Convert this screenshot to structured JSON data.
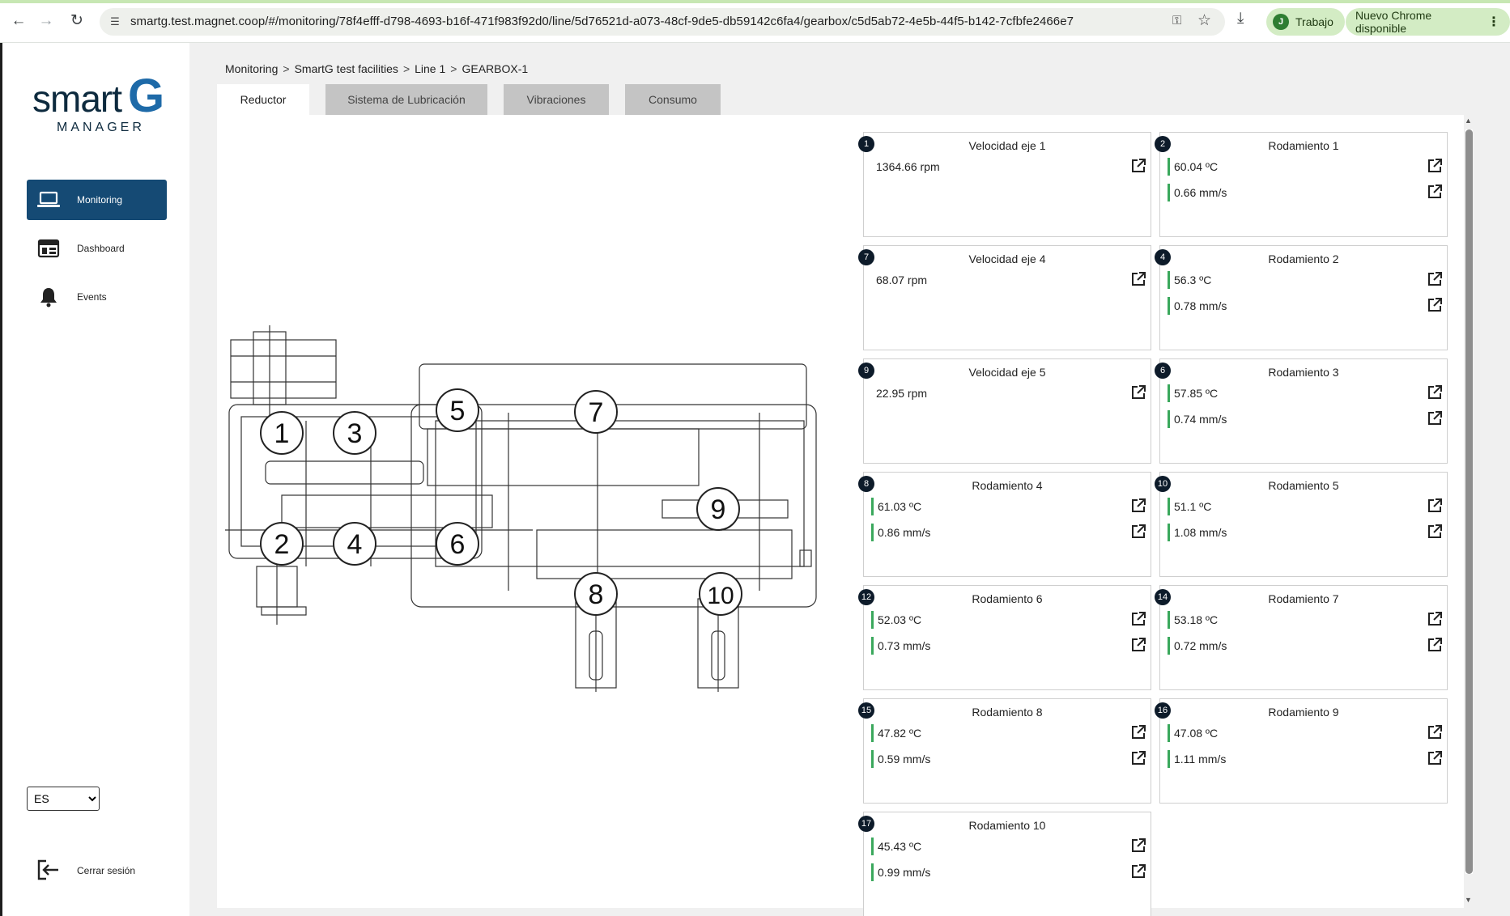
{
  "browser": {
    "url": "smartg.test.magnet.coop/#/monitoring/78f4efff-d798-4693-b16f-471f983f92d0/line/5d76521d-a073-48cf-9de5-db59142c6fa4/gearbox/c5d5ab72-4e5b-44f5-b142-7cfbfe2466e7",
    "profile_initial": "J",
    "profile_label": "Trabajo",
    "update_label": "Nuevo Chrome disponible",
    "accent_color": "#c7e7b3"
  },
  "logo": {
    "word": "smart",
    "letter": "G",
    "subtitle": "MANAGER"
  },
  "sidebar": {
    "items": [
      {
        "label": "Monitoring",
        "icon": "laptop-icon",
        "active": true
      },
      {
        "label": "Dashboard",
        "icon": "dashboard-icon",
        "active": false
      },
      {
        "label": "Events",
        "icon": "bell-icon",
        "active": false
      }
    ],
    "language": {
      "selected": "ES",
      "options": [
        "ES"
      ]
    },
    "logout_label": "Cerrar sesión",
    "active_color": "#154a74"
  },
  "breadcrumb": [
    "Monitoring",
    "SmartG test facilities",
    "Line 1",
    "GEARBOX-1"
  ],
  "breadcrumb_separator": ">",
  "tabs": [
    {
      "label": "Reductor",
      "active": true
    },
    {
      "label": "Sistema de Lubricación",
      "active": false
    },
    {
      "label": "Vibraciones",
      "active": false
    },
    {
      "label": "Consumo",
      "active": false
    }
  ],
  "diagram_markers": [
    "1",
    "2",
    "3",
    "4",
    "5",
    "6",
    "7",
    "8",
    "9",
    "10"
  ],
  "cards": [
    {
      "badge": "1",
      "title": "Velocidad eje 1",
      "values": [
        "1364.66 rpm"
      ],
      "status_bar": false
    },
    {
      "badge": "2",
      "title": "Rodamiento 1",
      "values": [
        "60.04 ºC",
        "0.66 mm/s"
      ],
      "status_bar": true
    },
    {
      "badge": "7",
      "title": "Velocidad eje 4",
      "values": [
        "68.07 rpm"
      ],
      "status_bar": false
    },
    {
      "badge": "4",
      "title": "Rodamiento 2",
      "values": [
        "56.3 ºC",
        "0.78 mm/s"
      ],
      "status_bar": true
    },
    {
      "badge": "9",
      "title": "Velocidad eje 5",
      "values": [
        "22.95 rpm"
      ],
      "status_bar": false
    },
    {
      "badge": "6",
      "title": "Rodamiento 3",
      "values": [
        "57.85 ºC",
        "0.74 mm/s"
      ],
      "status_bar": true
    },
    {
      "badge": "8",
      "title": "Rodamiento 4",
      "values": [
        "61.03 ºC",
        "0.86 mm/s"
      ],
      "status_bar": true
    },
    {
      "badge": "10",
      "title": "Rodamiento 5",
      "values": [
        "51.1 ºC",
        "1.08 mm/s"
      ],
      "status_bar": true
    },
    {
      "badge": "12",
      "title": "Rodamiento 6",
      "values": [
        "52.03 ºC",
        "0.73 mm/s"
      ],
      "status_bar": true
    },
    {
      "badge": "14",
      "title": "Rodamiento 7",
      "values": [
        "53.18 ºC",
        "0.72 mm/s"
      ],
      "status_bar": true
    },
    {
      "badge": "15",
      "title": "Rodamiento 8",
      "values": [
        "47.82 ºC",
        "0.59 mm/s"
      ],
      "status_bar": true
    },
    {
      "badge": "16",
      "title": "Rodamiento 9",
      "values": [
        "47.08 ºC",
        "1.11 mm/s"
      ],
      "status_bar": true
    },
    {
      "badge": "17",
      "title": "Rodamiento 10",
      "values": [
        "45.43 ºC",
        "0.99 mm/s"
      ],
      "status_bar": true
    }
  ],
  "colors": {
    "status_ok": "#3aa85c",
    "badge_bg": "#0d1b2a",
    "brand_blue": "#1e6aa8"
  },
  "icons": {
    "external_link": "external-link-icon"
  }
}
